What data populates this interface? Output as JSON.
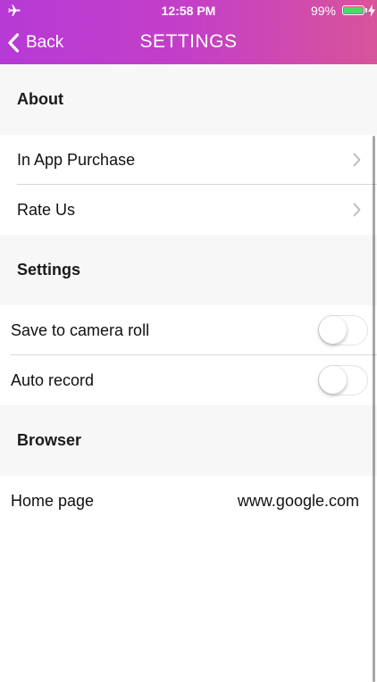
{
  "status_bar": {
    "time": "12:58 PM",
    "battery_percent": "99%",
    "battery_level": 0.99,
    "battery_color": "#4cd964",
    "left_icon": "airplane-icon",
    "charging_icon": "bolt-icon"
  },
  "navbar": {
    "back_label": "Back",
    "back_icon": "chevron-left-icon",
    "title": "SETTINGS",
    "gradient_colors": [
      "#b63ad6",
      "#c43fc7",
      "#d8549a"
    ]
  },
  "sections": {
    "about": {
      "header": "About",
      "rows": [
        {
          "label": "In App Purchase",
          "icon": "chevron-right-icon"
        },
        {
          "label": "Rate Us",
          "icon": "chevron-right-icon"
        }
      ]
    },
    "settings": {
      "header": "Settings",
      "rows": [
        {
          "label": "Save to camera roll",
          "toggle_on": false
        },
        {
          "label": "Auto record",
          "toggle_on": false
        }
      ]
    },
    "browser": {
      "header": "Browser",
      "rows": [
        {
          "label": "Home page",
          "value": "www.google.com"
        }
      ]
    }
  }
}
